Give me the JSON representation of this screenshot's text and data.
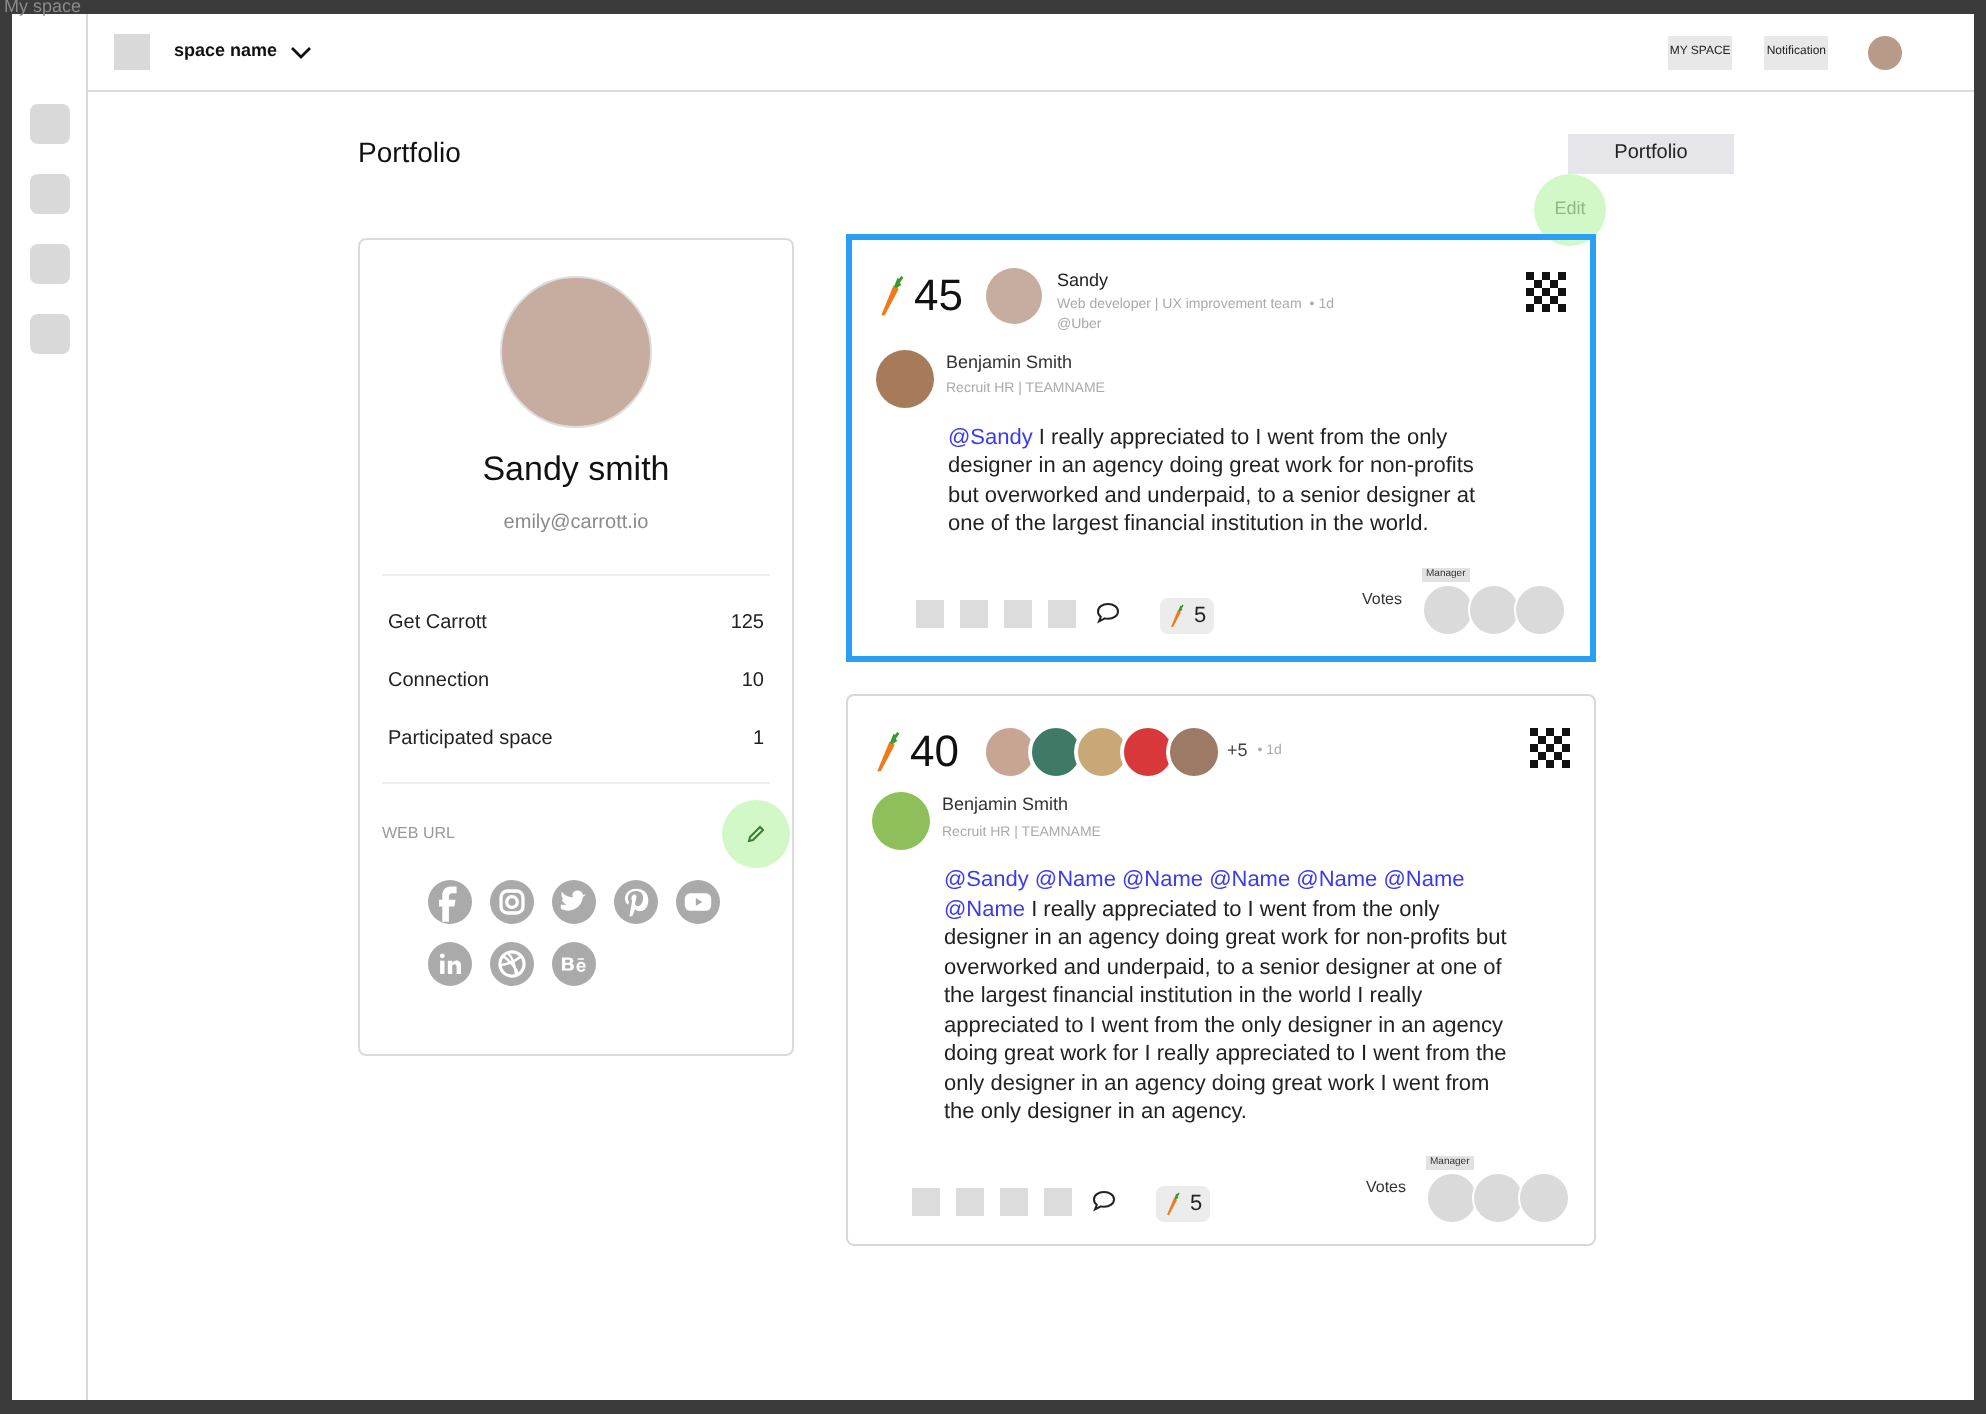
{
  "window": {
    "title": "My space"
  },
  "topbar": {
    "space_name": "space name",
    "links": [
      "MY SPACE",
      "Notification"
    ]
  },
  "page": {
    "title": "Portfolio",
    "tab_button": "Portfolio",
    "edit_hint": "Edit"
  },
  "profile": {
    "name": "Sandy smith",
    "email": "emily@carrott.io",
    "stats": [
      {
        "label": "Get Carrott",
        "value": "125"
      },
      {
        "label": "Connection",
        "value": "10"
      },
      {
        "label": "Participated space",
        "value": "1"
      }
    ],
    "web_url_label": "WEB URL",
    "socials": [
      {
        "kind": "facebook"
      },
      {
        "kind": "instagram"
      },
      {
        "kind": "twitter"
      },
      {
        "kind": "pinterest"
      },
      {
        "kind": "youtube"
      },
      {
        "kind": "linkedin"
      },
      {
        "kind": "dribbble"
      },
      {
        "kind": "behance"
      }
    ]
  },
  "posts": [
    {
      "selected": true,
      "score": "45",
      "recipient": {
        "name": "Sandy",
        "role": "Web developer | UX improvement team",
        "time": "• 1d",
        "org": "@Uber"
      },
      "author": {
        "name": "Benjamin Smith",
        "role": "Recruit HR | TEAMNAME"
      },
      "mentions": [
        "@Sandy"
      ],
      "body": "I really appreciated to I went from the only designer in an agency doing great work for non-profits but overworked and underpaid, to a senior designer at one of the largest financial institution in the world.",
      "carrots": "5",
      "votes_label": "Votes",
      "voter_tag": "Manager"
    },
    {
      "selected": false,
      "score": "40",
      "group": {
        "more": "+5",
        "time": "• 1d"
      },
      "author": {
        "name": "Benjamin Smith",
        "role": "Recruit HR | TEAMNAME"
      },
      "mentions": [
        "@Sandy",
        "@Name",
        "@Name",
        "@Name",
        "@Name",
        "@Name",
        "@Name"
      ],
      "body": "I really appreciated to I went from the only designer in an agency doing great work for non-profits but overworked and underpaid, to a senior designer at one of the largest financial institution in the world I really appreciated to I went from the only designer in an agency doing great work for I really appreciated to I went from the only designer in an agency doing great work I went from the only designer in an agency.",
      "carrots": "5",
      "votes_label": "Votes",
      "voter_tag": "Manager"
    }
  ]
}
